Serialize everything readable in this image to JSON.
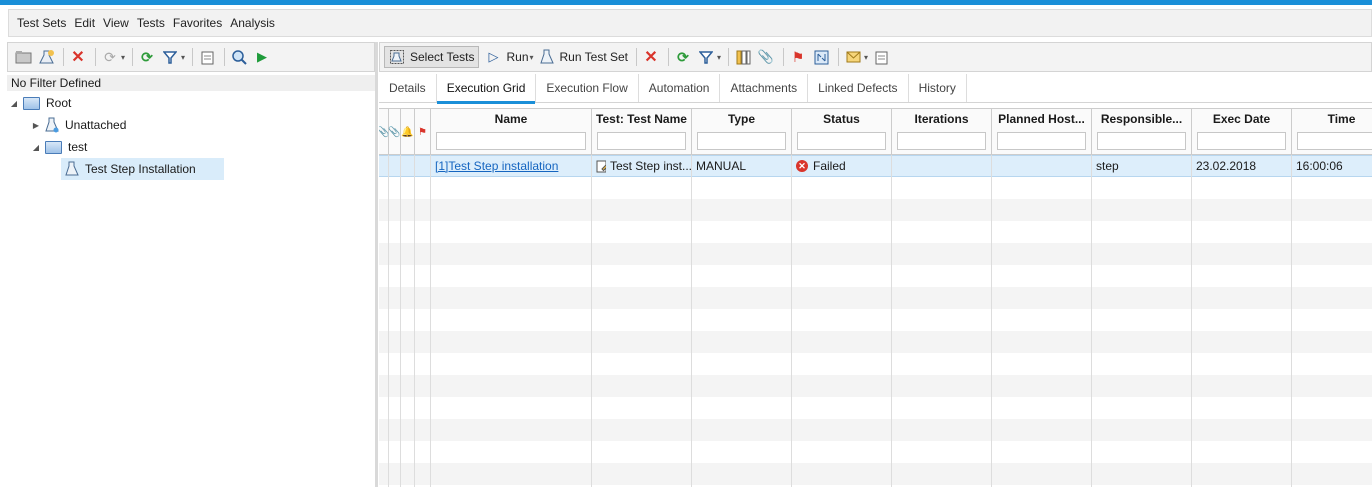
{
  "menu": [
    "Test Sets",
    "Edit",
    "View",
    "Tests",
    "Favorites",
    "Analysis"
  ],
  "left_toolbar_icons": [
    "new-folder-icon",
    "new-test-set-icon",
    "delete-icon",
    "refresh-dimmed-icon",
    "refresh-icon",
    "filter-icon",
    "edit-icon",
    "find-icon",
    "run-icon"
  ],
  "filter_text": "No Filter Defined",
  "tree": {
    "root": "Root",
    "unattached": "Unattached",
    "test_folder": "test",
    "selected_item": "Test Step Installation"
  },
  "right_toolbar": {
    "select_tests": "Select Tests",
    "run": "Run",
    "run_test_set": "Run Test Set"
  },
  "tabs": [
    "Details",
    "Execution Grid",
    "Execution Flow",
    "Automation",
    "Attachments",
    "Linked Defects",
    "History"
  ],
  "active_tab": "Execution Grid",
  "grid": {
    "columns": [
      "Name",
      "Test: Test Name",
      "Type",
      "Status",
      "Iterations",
      "Planned Host...",
      "Responsible...",
      "Exec Date",
      "Time"
    ],
    "rows": [
      {
        "name": "[1]Test Step installation",
        "test_name": "Test Step inst...",
        "type": "MANUAL",
        "status": "Failed",
        "iterations": "",
        "planned_host": "",
        "responsible": "step",
        "exec_date": "23.02.2018",
        "time": "16:00:06"
      }
    ]
  },
  "colors": {
    "accent": "#1a8fd8",
    "failed": "#d9342b",
    "link": "#1565c0",
    "selected_row": "#ddeefb"
  }
}
